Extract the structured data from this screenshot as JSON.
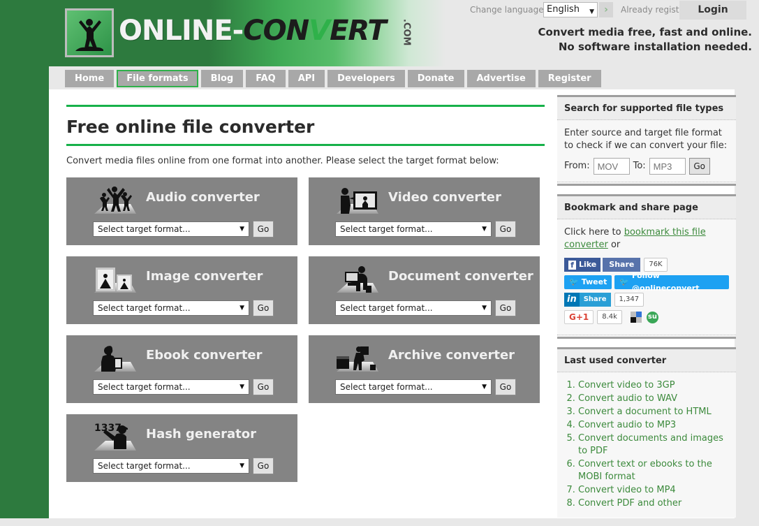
{
  "header": {
    "language_label": "Change language:",
    "language_value": "English",
    "language_go": "›",
    "already_registered": "Already registered?",
    "login_label": "Login",
    "tagline_line1": "Convert media free, fast and online.",
    "tagline_line2": "No software installation needed.",
    "logo": {
      "part1": "ONLINE",
      "dash": "-",
      "part2": "CON",
      "part3": "V",
      "part4": "ERT",
      "tld": ".COM"
    }
  },
  "nav": {
    "items": [
      {
        "label": "Home",
        "active": false
      },
      {
        "label": "File formats",
        "active": true
      },
      {
        "label": "Blog",
        "active": false
      },
      {
        "label": "FAQ",
        "active": false
      },
      {
        "label": "API",
        "active": false
      },
      {
        "label": "Developers",
        "active": false
      },
      {
        "label": "Donate",
        "active": false
      },
      {
        "label": "Advertise",
        "active": false
      },
      {
        "label": "Register",
        "active": false
      }
    ]
  },
  "main": {
    "title": "Free online file converter",
    "intro": "Convert media files online from one format into another. Please select the target format below:",
    "select_placeholder": "Select target format...",
    "go_label": "Go",
    "converters": [
      {
        "title": "Audio converter",
        "icon": "audio-dancers-icon"
      },
      {
        "title": "Video converter",
        "icon": "video-camera-icon"
      },
      {
        "title": "Image converter",
        "icon": "image-frames-icon"
      },
      {
        "title": "Document converter",
        "icon": "document-desk-icon"
      },
      {
        "title": "Ebook converter",
        "icon": "ebook-reader-icon"
      },
      {
        "title": "Archive converter",
        "icon": "archive-boxes-icon"
      },
      {
        "title": "Hash generator",
        "icon": "hash-graffiti-icon"
      }
    ]
  },
  "sidebar": {
    "search_widget": {
      "title": "Search for supported file types",
      "description": "Enter source and target file format to check if we can convert your file:",
      "from_label": "From:",
      "from_placeholder": "MOV",
      "to_label": "To:",
      "to_placeholder": "MP3",
      "go_label": "Go"
    },
    "share_widget": {
      "title": "Bookmark and share page",
      "text_before": "Click here to ",
      "link_text": "bookmark this file converter",
      "text_after": " or",
      "facebook_like": "Like",
      "facebook_share": "Share",
      "facebook_count": "76K",
      "twitter_tweet": "Tweet",
      "twitter_follow": "Follow @onlineconvert",
      "linkedin_in": "in",
      "linkedin_share": "Share",
      "linkedin_count": "1,347",
      "google_plus": "G+1",
      "google_count": "8.4k"
    },
    "last_used_widget": {
      "title": "Last used converter",
      "items": [
        "Convert video to 3GP",
        "Convert audio to WAV",
        "Convert a document to HTML",
        "Convert audio to MP3",
        "Convert documents and images to PDF",
        "Convert text or ebooks to the MOBI format",
        "Convert video to MP4",
        "Convert PDF and other"
      ]
    }
  },
  "colors": {
    "brand_green": "#17b14a",
    "dark_green": "#2d7a3e",
    "card_gray": "#848484",
    "link_green": "#3c8a3c"
  }
}
